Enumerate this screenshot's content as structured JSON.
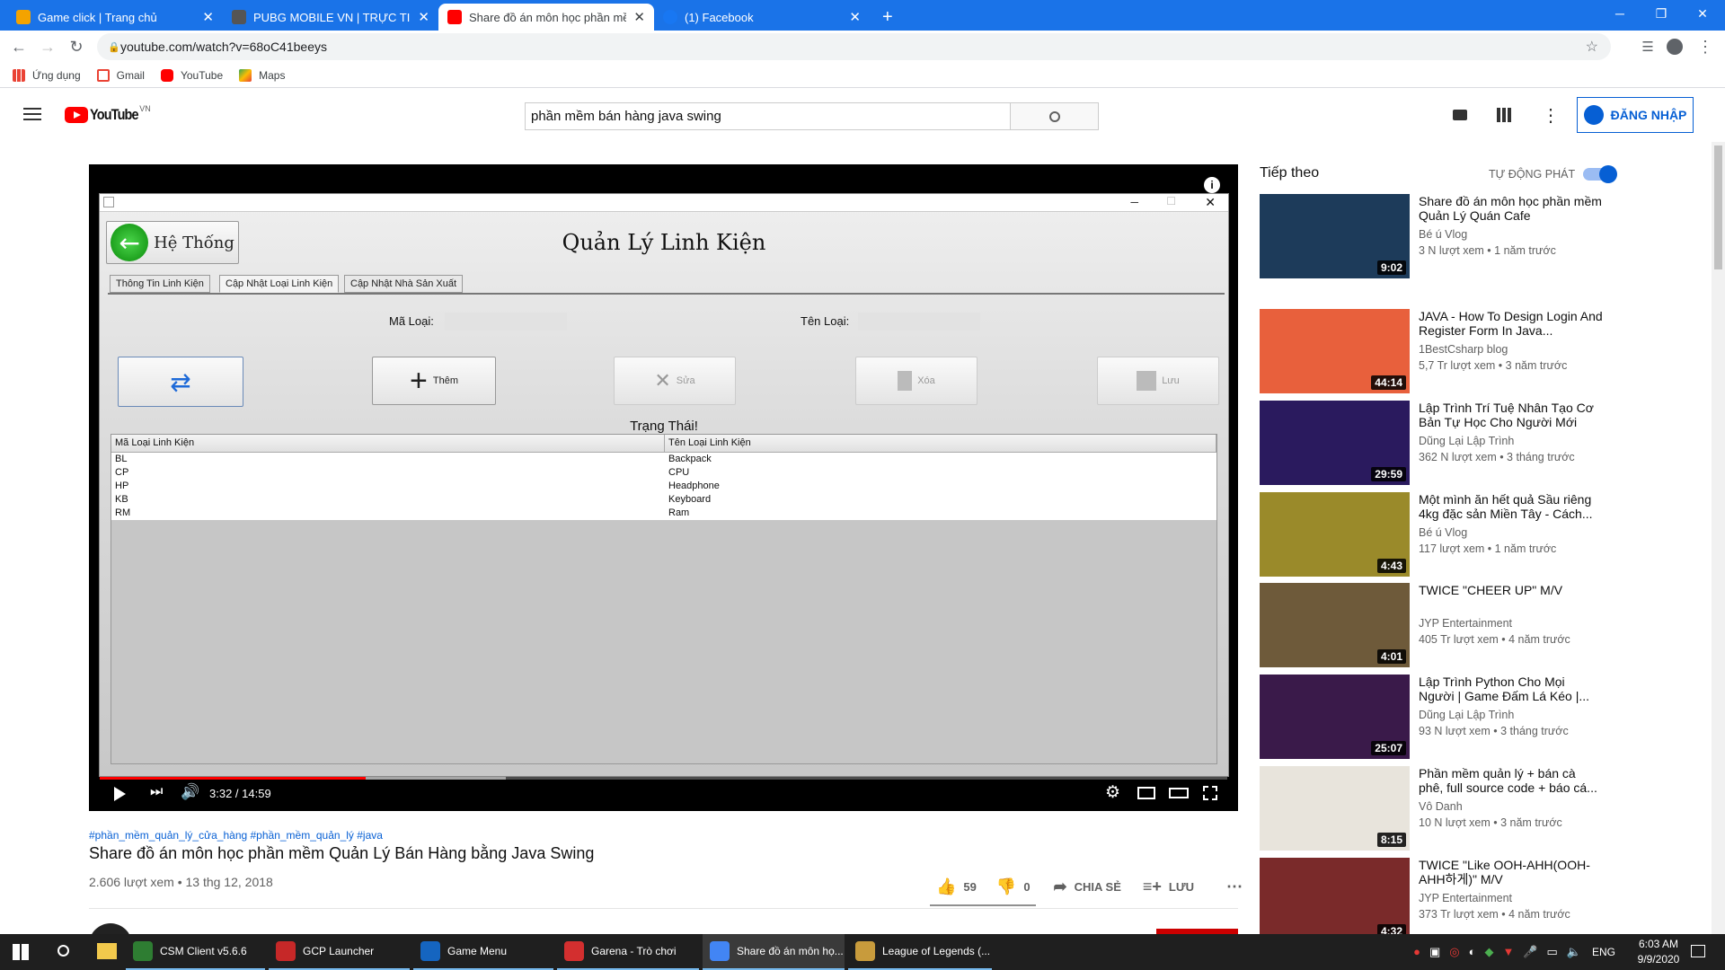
{
  "browser": {
    "tabs": [
      {
        "title": "Game click | Trang chủ",
        "color": "#f4a300"
      },
      {
        "title": "PUBG MOBILE VN | TRỰC TIẾP GI...",
        "color": "#555"
      },
      {
        "title": "Share đồ án môn học phần mềm...",
        "color": "#ff0000"
      },
      {
        "title": "(1) Facebook",
        "color": "#1877f2"
      }
    ],
    "new_tab": "+",
    "url": "youtube.com/watch?v=68oC41beeys",
    "bookmarks": [
      {
        "label": "Ứng dụng",
        "icon": "apps-grid-icon"
      },
      {
        "label": "Gmail",
        "icon": "gmail-icon"
      },
      {
        "label": "YouTube",
        "icon": "youtube-icon"
      },
      {
        "label": "Maps",
        "icon": "maps-icon"
      }
    ]
  },
  "youtube": {
    "logo_text": "YouTube",
    "region": "VN",
    "search_value": "phần mềm bán hàng java swing",
    "signin_label": "ĐĂNG NHẬP"
  },
  "video_app": {
    "back_label": "Hệ Thống",
    "title": "Quản Lý Linh Kiện",
    "tabs": [
      "Thông Tin Linh Kiện",
      "Cập Nhật Loại Linh Kiện",
      "Cập Nhật Nhà Sản Xuất"
    ],
    "field_code_label": "Mã Loại:",
    "field_name_label": "Tên Loại:",
    "buttons": [
      "Thêm",
      "Sửa",
      "Xóa",
      "Lưu"
    ],
    "status_label": "Trạng Thái!",
    "columns": [
      "Mã Loại Linh Kiện",
      "Tên Loại Linh Kiện"
    ],
    "rows": [
      [
        "BL",
        "Backpack"
      ],
      [
        "CP",
        "CPU"
      ],
      [
        "HP",
        "Headphone"
      ],
      [
        "KB",
        "Keyboard"
      ],
      [
        "RM",
        "Ram"
      ]
    ]
  },
  "player": {
    "time": "3:32 / 14:59",
    "progress": 0.236,
    "buffered": 0.36
  },
  "video": {
    "hashtags": "#phần_mềm_quản_lý_cửa_hàng #phần_mềm_quản_lý #java",
    "title": "Share đồ án môn học phần mềm Quản Lý Bán Hàng bằng Java Swing",
    "views_date": "2.606 lượt xem • 13 thg 12, 2018",
    "likes": "59",
    "dislikes": "0",
    "share_label": "CHIA SẺ",
    "save_label": "LƯU"
  },
  "sidebar": {
    "heading": "Tiếp theo",
    "autoplay_label": "TỰ ĐỘNG PHÁT",
    "items": [
      {
        "title": "Share đồ án môn học phần mềm Quản Lý Quán Cafe",
        "channel": "Bé ú Vlog",
        "views": "3 N lượt xem • 1 năm trước",
        "duration": "9:02",
        "color": "#1d3b5a"
      },
      {
        "title": "JAVA - How To Design Login And Register Form In Java...",
        "channel": "1BestCsharp blog",
        "views": "5,7 Tr lượt xem • 3 năm trước",
        "duration": "44:14",
        "color": "#e8603c"
      },
      {
        "title": "Lập Trình Trí Tuệ Nhân Tạo Cơ Bản Tự Học Cho Người Mới Bắ...",
        "channel": "Dũng Lại Lập Trình",
        "views": "362 N lượt xem • 3 tháng trước",
        "duration": "29:59",
        "color": "#2a1a5e"
      },
      {
        "title": "Một mình ăn hết quả Sầu riêng 4kg đặc sản Miền Tây - Cách...",
        "channel": "Bé ú Vlog",
        "views": "117 lượt xem • 1 năm trước",
        "duration": "4:43",
        "color": "#9a8a2a"
      },
      {
        "title": "TWICE \"CHEER UP\" M/V",
        "channel": "JYP Entertainment",
        "views": "405 Tr lượt xem • 4 năm trước",
        "duration": "4:01",
        "color": "#6e5a3a"
      },
      {
        "title": "Lập Trình Python Cho Mọi Người | Game Đấm Lá Kéo |...",
        "channel": "Dũng Lại Lập Trình",
        "views": "93 N lượt xem • 3 tháng trước",
        "duration": "25:07",
        "color": "#3a1a4a"
      },
      {
        "title": "Phần mềm quản lý + bán cà phê, full source code + báo cá...",
        "channel": "Vô Danh",
        "views": "10 N lượt xem • 3 năm trước",
        "duration": "8:15",
        "color": "#e8e4dc"
      },
      {
        "title": "TWICE \"Like OOH-AHH(OOH-AHH하게)\" M/V",
        "channel": "JYP Entertainment",
        "views": "373 Tr lượt xem • 4 năm trước",
        "duration": "4:32",
        "color": "#7a2a2a"
      }
    ]
  },
  "taskbar": {
    "apps": [
      {
        "label": "CSM Client v5.6.6",
        "color": "#2e7d32"
      },
      {
        "label": "GCP Launcher",
        "color": "#c62828"
      },
      {
        "label": "Game Menu",
        "color": "#1565c0"
      },
      {
        "label": "Garena - Trò chơi",
        "color": "#d32f2f"
      },
      {
        "label": "Share đồ án môn họ...",
        "color": "#4285f4"
      },
      {
        "label": "League of Legends (...",
        "color": "#c89b3c"
      }
    ],
    "lang": "ENG",
    "time": "6:03 AM",
    "date": "9/9/2020"
  }
}
